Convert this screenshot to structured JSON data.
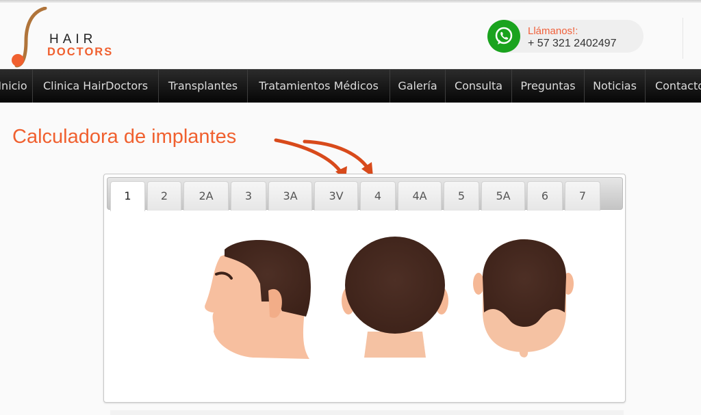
{
  "brand": {
    "line1": "HAIR",
    "line2": "DOCTORS",
    "accent": "#f0602f"
  },
  "contact": {
    "icon": "whatsapp-icon",
    "label": "Llámanos!:",
    "phone": "+ 57 321 2402497"
  },
  "nav": {
    "items": [
      {
        "label": "Inicio"
      },
      {
        "label": "Clinica HairDoctors"
      },
      {
        "label": "Transplantes"
      },
      {
        "label": "Tratamientos Médicos"
      },
      {
        "label": "Galería"
      },
      {
        "label": "Consulta"
      },
      {
        "label": "Preguntas"
      },
      {
        "label": "Noticias"
      },
      {
        "label": "Contacto"
      }
    ]
  },
  "page": {
    "title": "Calculadora de implantes"
  },
  "calculator": {
    "selected_tab": "1",
    "tabs": [
      {
        "label": "1"
      },
      {
        "label": "2"
      },
      {
        "label": "2A"
      },
      {
        "label": "3"
      },
      {
        "label": "3A"
      },
      {
        "label": "3V"
      },
      {
        "label": "4"
      },
      {
        "label": "4A"
      },
      {
        "label": "5"
      },
      {
        "label": "5A"
      },
      {
        "label": "6"
      },
      {
        "label": "7"
      }
    ],
    "illustrations": [
      "head-side-view",
      "head-back-view",
      "head-top-view"
    ],
    "annotation": "arrows pointing to tabs 3V and 4"
  }
}
